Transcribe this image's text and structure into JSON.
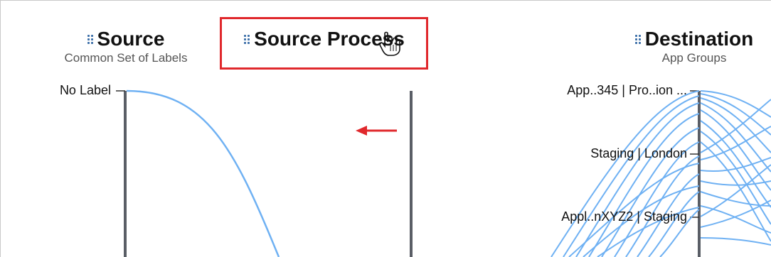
{
  "columns": {
    "source": {
      "title": "Source",
      "subtitle": "Common Set of Labels"
    },
    "source_process": {
      "title": "Source Process"
    },
    "destination": {
      "title": "Destination",
      "subtitle": "App Groups"
    }
  },
  "source_axis": {
    "labels": [
      "No Label"
    ]
  },
  "destination_axis": {
    "labels": [
      "App..345 | Pro..ion ...",
      "Staging | London",
      "Appl..nXYZ2 | Staging"
    ]
  },
  "colors": {
    "axis": "#5a5e66",
    "link": "#6fb1f3",
    "highlight": "#e0282c",
    "grip": "#3b6ea8"
  },
  "icons": {
    "drag_handle": "grip-dots-icon",
    "cursor": "hand-cursor-icon",
    "arrow": "left-arrow-icon"
  }
}
